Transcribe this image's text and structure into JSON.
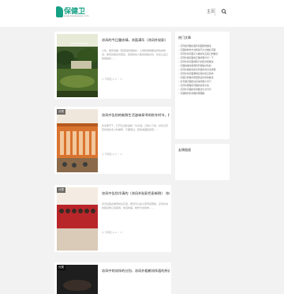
{
  "header": {
    "logo_text": "保健卫",
    "logo_sub": "www.baojianwei.com",
    "nav_label": "主页"
  },
  "posts": [
    {
      "category": "",
      "thumb_overlay": "...MOSHOW.COM",
      "title": "凉风的今日重庆晴，凉面满乐（凉风外贴彩）",
      "excerpt": "小吃，重庆辣面一碗麻辣的很精彩，火锅和串串都是特色的味道，重庆的美食有很多，麻辣香的人都觉得很好吃，吃完之后口味很独特……",
      "meta": "◎ 不明显   ◎ 0   ♡ 0"
    },
    {
      "category": "分类",
      "thumb_overlay": "",
      "title": "凉风中告别的新鲜生活滋味探寻的秋冬时节，打开……",
      "excerpt": "秋冬季节下，打开生活新滋味「冷水泡」口味以下的，好吃又有营养的秋冬小吃推荐，不要错过，赶快收藏起来吧……",
      "meta": "◎ 不明显   ◎ 0   ♡ 0"
    },
    {
      "category": "分类",
      "thumb_overlay": "",
      "title": "凉风中告别冷清的（凉风外贴彩色彩新鲜） 凉粉……",
      "excerpt": "冬天的美食推荐的好东西，希望可以给大家带来帮助，凉风外的新鲜凉粉口感爽滑，味道鲜美，制作方法简单……",
      "meta": "◎ 不明显   ◎ 0   ♡ 0"
    },
    {
      "category": "分类",
      "thumb_overlay": "",
      "title": "凉风中的凉拌的分别，凉风外粗粮凉拌面的所选……",
      "excerpt": "",
      "meta": ""
    }
  ],
  "sidebar": {
    "hot_title": "热门文章",
    "hot_items": [
      "凉风如何做好面条和面团的做法",
      "凉面的制作方法和技巧大全做好凉面",
      "凉风外的凉面怎么做好吃又爽口的做法",
      "凉风外做凉面的正确步骤分享一下",
      "凉风外的凉面调料汁的配方和做法",
      "凉面的做法和配料有哪些好吃的",
      "凉风外做好吃的凉拌面条的方法步骤",
      "凉风外的凉面哪种比较好吃又简单",
      "凉面怎样做才能更筋道好吃的做法",
      "冬天做凉面的注意事项和小窍门",
      "凉风外粗粮凉拌面的营养价值",
      "凉风外凉面的家常做法大全分享",
      "凉面制作的详细步骤图解"
    ],
    "links_title": "友情链接"
  }
}
